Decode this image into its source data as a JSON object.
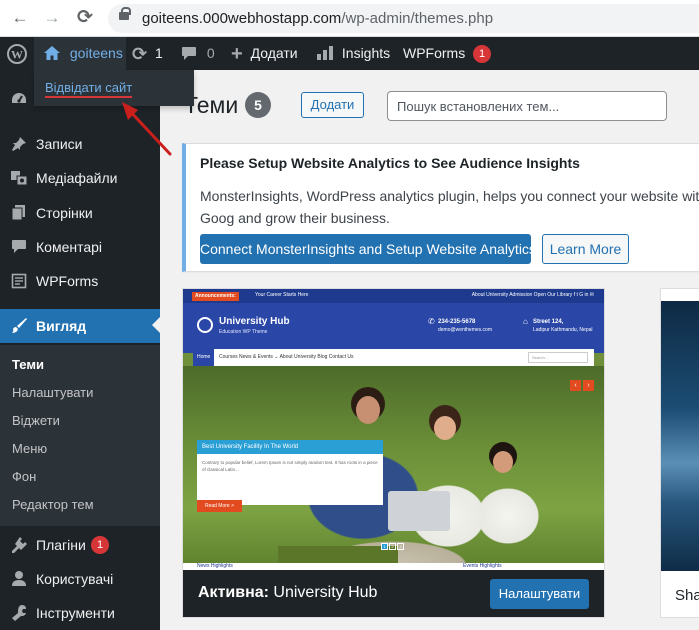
{
  "browser": {
    "back_icon": "←",
    "forward_icon": "→",
    "reload_icon": "⟳",
    "url_host": "goiteens.000webhostapp.com",
    "url_path": "/wp-admin/themes.php"
  },
  "adminbar": {
    "site_name": "goiteens",
    "updates_count": "1",
    "comments_count": "0",
    "new_label": "Додати",
    "insights_label": "Insights",
    "wpforms_label": "WPForms",
    "wpforms_badge": "1",
    "dropdown_visit_site": "Відвідати сайт"
  },
  "sidebar": {
    "items": [
      {
        "label": "Записи",
        "icon": "pin-icon"
      },
      {
        "label": "Медіафайли",
        "icon": "media-icon"
      },
      {
        "label": "Сторінки",
        "icon": "pages-icon"
      },
      {
        "label": "Коментарі",
        "icon": "comments-icon"
      },
      {
        "label": "WPForms",
        "icon": "wpforms-icon"
      },
      {
        "label": "Вигляд",
        "icon": "appearance-icon"
      },
      {
        "label": "Плагіни",
        "icon": "plugins-icon",
        "badge": "1"
      },
      {
        "label": "Користувачі",
        "icon": "users-icon"
      },
      {
        "label": "Інструменти",
        "icon": "tools-icon"
      }
    ],
    "submenu": [
      "Теми",
      "Налаштувати",
      "Віджети",
      "Меню",
      "Фон",
      "Редактор тем"
    ]
  },
  "main": {
    "title": "Теми",
    "theme_count": "5",
    "add_button": "Додати",
    "search_placeholder": "Пошук встановлених тем..."
  },
  "notice": {
    "title": "Please Setup Website Analytics to See Audience Insights",
    "body": "MonsterInsights, WordPress analytics plugin, helps you connect your website with Goog and grow their business.",
    "primary_button": "Connect MonsterInsights and Setup Website Analytics",
    "secondary_button": "Learn More"
  },
  "active_theme": {
    "prefix": "Активна:",
    "name": "University Hub",
    "customize_button": "Налаштувати",
    "screenshot": {
      "announcement": "Announcements:",
      "announcement_text": "Your Career Starts Here",
      "top_links": "About University   Admission Open   Our Library   f  t  G  in  ✉",
      "site_title": "University Hub",
      "tagline": "Education WP Theme",
      "phone": "234-235-5678",
      "email": "demo@wenthemes.com",
      "address_line1": "Street 124,",
      "address_line2": "Ladipur Kathmandu, Nepal",
      "nav_home": "Home",
      "nav_items": "Courses    News & Events ⌄    About University    Blog    Contact Us",
      "search_placeholder": "Search...",
      "slide_title": "Best University Facility In The World",
      "slide_text": "Contrary to popular belief, Lorem Ipsum is not simply random text. It has roots in a piece of classical Latin...",
      "read_more": "Read More >",
      "news_label": "News Highlights",
      "events_label": "Events Highlights"
    }
  },
  "second_theme": {
    "name_fragment": "Sha"
  },
  "colors": {
    "admin_dark": "#1d2327",
    "wp_blue": "#2271b1",
    "badge_red": "#d63638",
    "notice_blue": "#72aee6"
  }
}
